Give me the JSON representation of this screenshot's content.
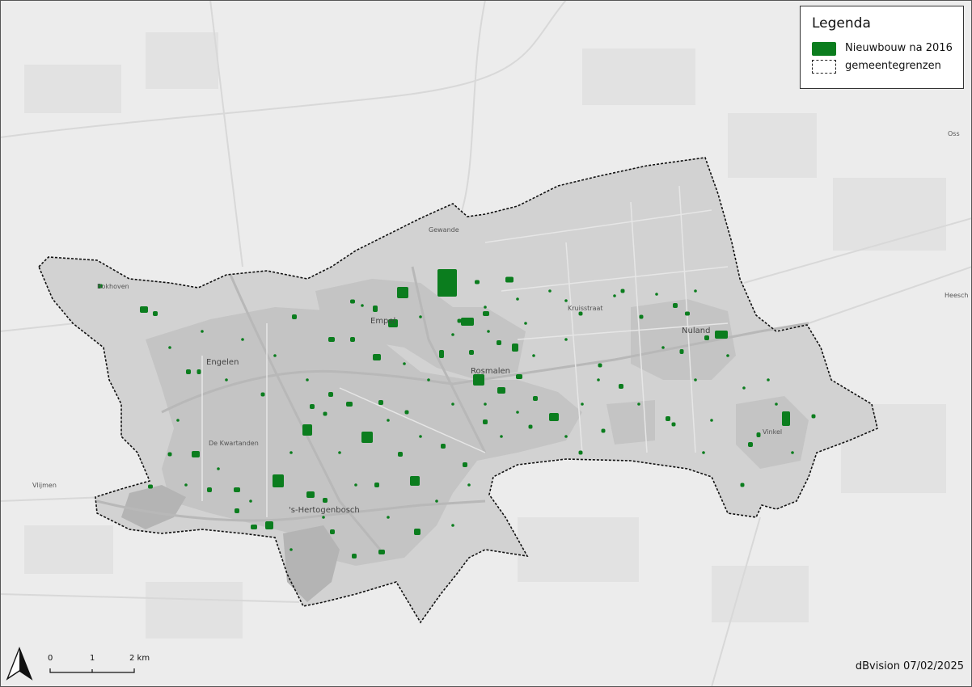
{
  "legend": {
    "title": "Legenda",
    "items": [
      {
        "label": "Nieuwbouw na 2016",
        "color": "#0b7d1e"
      },
      {
        "label": "gemeentegrenzen"
      }
    ]
  },
  "places": {
    "bokhoven": "Bokhoven",
    "engelen": "Engelen",
    "empel": "Empel",
    "gewande": "Gewande",
    "rosmalen": "Rosmalen",
    "kruisstraat": "Kruisstraat",
    "nuland": "Nuland",
    "vinkel": "Vinkel",
    "hertogenbosch": "'s-Hertogenbosch",
    "kwartanden": "De Kwartanden",
    "vlijmen": "Vlijmen",
    "heesch": "Heesch",
    "oss": "Oss"
  },
  "scalebar": {
    "labels": [
      "0",
      "1",
      "2 km"
    ]
  },
  "north_arrow": "north-arrow-icon",
  "credit": "dBvision 07/02/2025"
}
